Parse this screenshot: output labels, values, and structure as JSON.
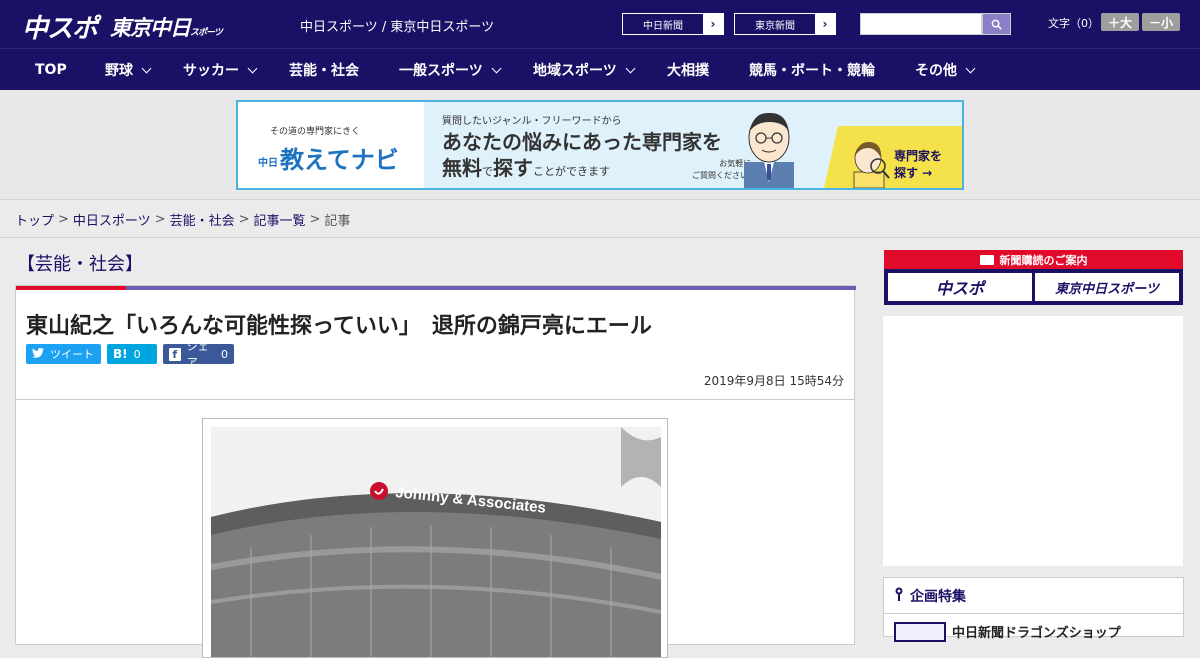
{
  "header": {
    "logo_main": "中スポ",
    "logo_tokyo": "東京中日",
    "logo_tokyo_suffix": "スポーツ",
    "subtitle": "中日スポーツ / 東京中日スポーツ",
    "paper_buttons": [
      {
        "label": "中日新聞"
      },
      {
        "label": "東京新聞"
      }
    ],
    "search_placeholder": "",
    "font_size_label": "文字（0）",
    "font_plus": "＋大",
    "font_minus": "－小"
  },
  "nav": {
    "items": [
      {
        "label": "TOP",
        "dropdown": false
      },
      {
        "label": "野球",
        "dropdown": true
      },
      {
        "label": "サッカー",
        "dropdown": true
      },
      {
        "label": "芸能・社会",
        "dropdown": false
      },
      {
        "label": "一般スポーツ",
        "dropdown": true
      },
      {
        "label": "地域スポーツ",
        "dropdown": true
      },
      {
        "label": "大相撲",
        "dropdown": false
      },
      {
        "label": "競馬・ボート・競輪",
        "dropdown": false
      },
      {
        "label": "その他",
        "dropdown": true
      }
    ]
  },
  "ad_banner": {
    "small_text": "その道の専門家にきく",
    "brand": "教えてナビ",
    "brand_prefix": "中日",
    "line1": "質問したいジャンル・フリーワードから",
    "line2": "あなたの悩みにあった専門家を",
    "line3_a": "無料",
    "line3_b": "で",
    "line3_c": "探す",
    "line3_d": "ことができます",
    "note": "お気軽に\nご質問ください!",
    "cta": "専門家を\n探す →",
    "colors": {
      "border": "#4ab3e0",
      "brand": "#1e73c0",
      "cta_bg": "#f5e14a"
    }
  },
  "breadcrumb": {
    "items": [
      "トップ",
      "中日スポーツ",
      "芸能・社会",
      "記事一覧"
    ],
    "current": "記事",
    "separator": ">"
  },
  "main": {
    "category_heading": "【芸能・社会】",
    "article": {
      "title": "東山紀之「いろんな可能性探っていい」　退所の錦戸亮にエール",
      "date": "2019年9月8日 15時54分",
      "share": {
        "tweet_label": "ツイート",
        "hatena_label": "B!",
        "hatena_count": "0",
        "facebook_label": "シェア",
        "facebook_count": "0"
      },
      "photo_sign_text": "Johnny & Associates"
    }
  },
  "sidebar": {
    "subscribe_head": "新聞購読のご案内",
    "subscribe_buttons": [
      "中スポ",
      "東京中日スポーツ"
    ],
    "feature_heading": "企画特集",
    "feature_item": "中日新聞ドラゴンズショップ"
  },
  "colors": {
    "brand_navy": "#1a1066",
    "accent_red": "#e20a2a",
    "twitter": "#1da1f2",
    "hatena": "#00a4de",
    "facebook": "#3b5998"
  }
}
